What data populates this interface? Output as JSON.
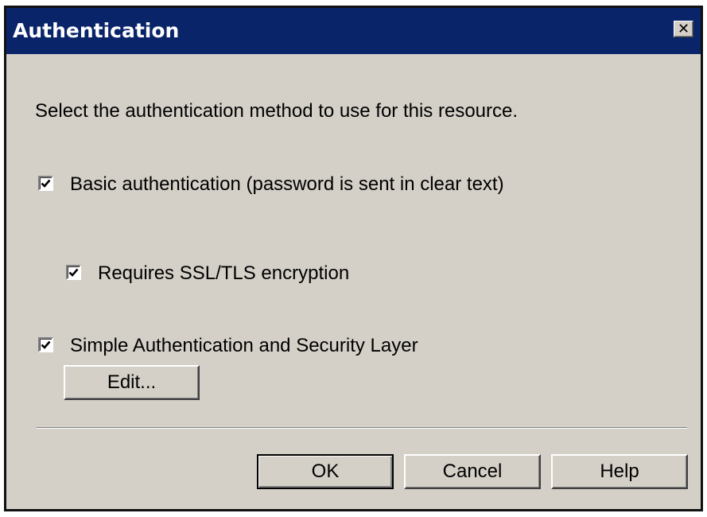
{
  "window": {
    "title": "Authentication",
    "close_icon": "close-icon"
  },
  "dialog": {
    "description": "Select the authentication method to use for this resource.",
    "options": [
      {
        "label": "Basic authentication (password is sent in clear text)",
        "checked": true
      },
      {
        "label": "Requires SSL/TLS encryption",
        "checked": true
      },
      {
        "label": "Simple Authentication and Security Layer",
        "checked": true
      }
    ],
    "edit_label": "Edit..."
  },
  "buttons": {
    "ok": "OK",
    "cancel": "Cancel",
    "help": "Help"
  },
  "colors": {
    "titlebar": "#0a246a",
    "face": "#d4d0c8"
  }
}
